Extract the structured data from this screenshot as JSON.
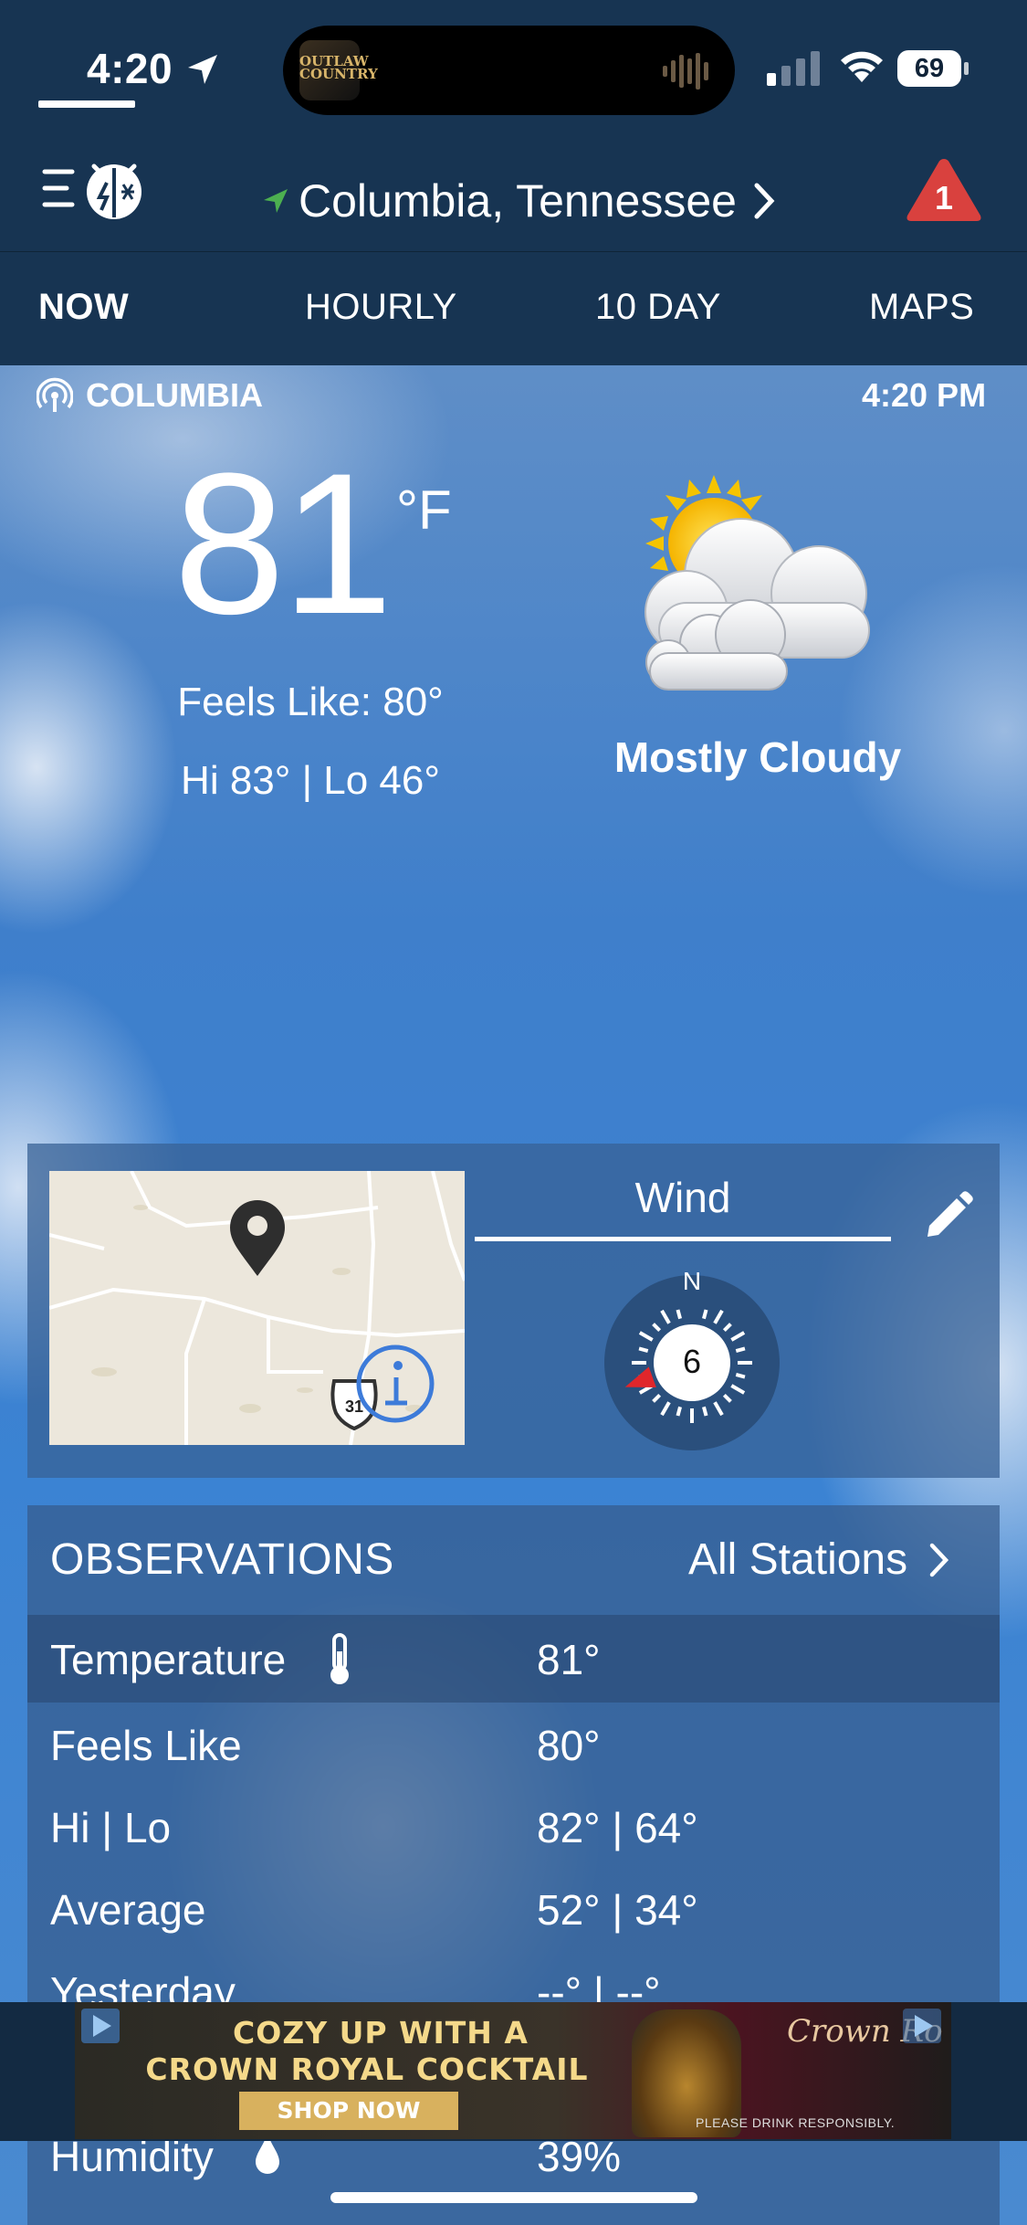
{
  "status": {
    "time": "4:20",
    "battery": "69",
    "now_playing_art": "OUTLAW COUNTRY"
  },
  "header": {
    "location": "Columbia,  Tennessee",
    "alert_count": "1"
  },
  "tabs": [
    {
      "label": "NOW",
      "active": true
    },
    {
      "label": "HOURLY"
    },
    {
      "label": "10  DAY"
    },
    {
      "label": "MAPS"
    }
  ],
  "current": {
    "station": "COLUMBIA",
    "time": "4:20 PM",
    "temp": "81",
    "unit": "°F",
    "feels_like": "Feels Like: 80°",
    "hi_lo": "Hi 83° | Lo 46°",
    "condition": "Mostly Cloudy",
    "icon": "partly-sunny-cloud-icon"
  },
  "map": {
    "route_shield": "31"
  },
  "wind": {
    "title": "Wind",
    "speed": "6",
    "north_label": "N",
    "direction_deg": 250
  },
  "observations": {
    "title": "OBSERVATIONS",
    "all_stations": "All Stations",
    "rows": [
      {
        "label": "Temperature",
        "value": "81°"
      },
      {
        "label": "Feels Like",
        "value": "80°"
      },
      {
        "label": "Hi | Lo",
        "value": "82° | 64°"
      },
      {
        "label": "Average",
        "value": "52° | 34°"
      },
      {
        "label": "Yesterday",
        "value": "--° | --°"
      },
      {
        "label": "Humidity",
        "value": "39%"
      }
    ]
  },
  "ad": {
    "line1": "COZY UP WITH A",
    "line2": "CROWN ROYAL COCKTAIL",
    "button": "SHOP NOW",
    "brand": "Crown Ro",
    "fine_print": "PLEASE DRINK RESPONSIBLY."
  },
  "colors": {
    "header_bg": "#173452",
    "alert_red": "#d9413e",
    "compass_bg": "#2a4f7c",
    "compass_needle": "#e0262b"
  }
}
